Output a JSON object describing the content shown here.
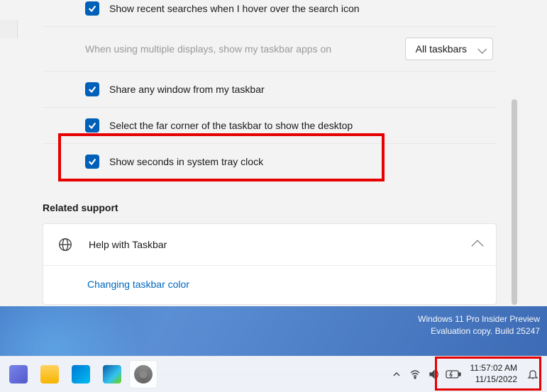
{
  "options": {
    "recentSearches": "Show recent searches when I hover over the search icon",
    "multiDisplay": "When using multiple displays, show my taskbar apps on",
    "multiDisplayValue": "All taskbars",
    "shareWindow": "Share any window from my taskbar",
    "farCorner": "Select the far corner of the taskbar to show the desktop",
    "showSeconds": "Show seconds in system tray clock"
  },
  "relatedSupport": {
    "title": "Related support",
    "helpTitle": "Help with Taskbar",
    "link1": "Changing taskbar color"
  },
  "watermark": {
    "line1": "Windows 11 Pro Insider Preview",
    "line2": "Evaluation copy. Build 25247"
  },
  "clock": {
    "time": "11:57:02 AM",
    "date": "11/15/2022"
  }
}
